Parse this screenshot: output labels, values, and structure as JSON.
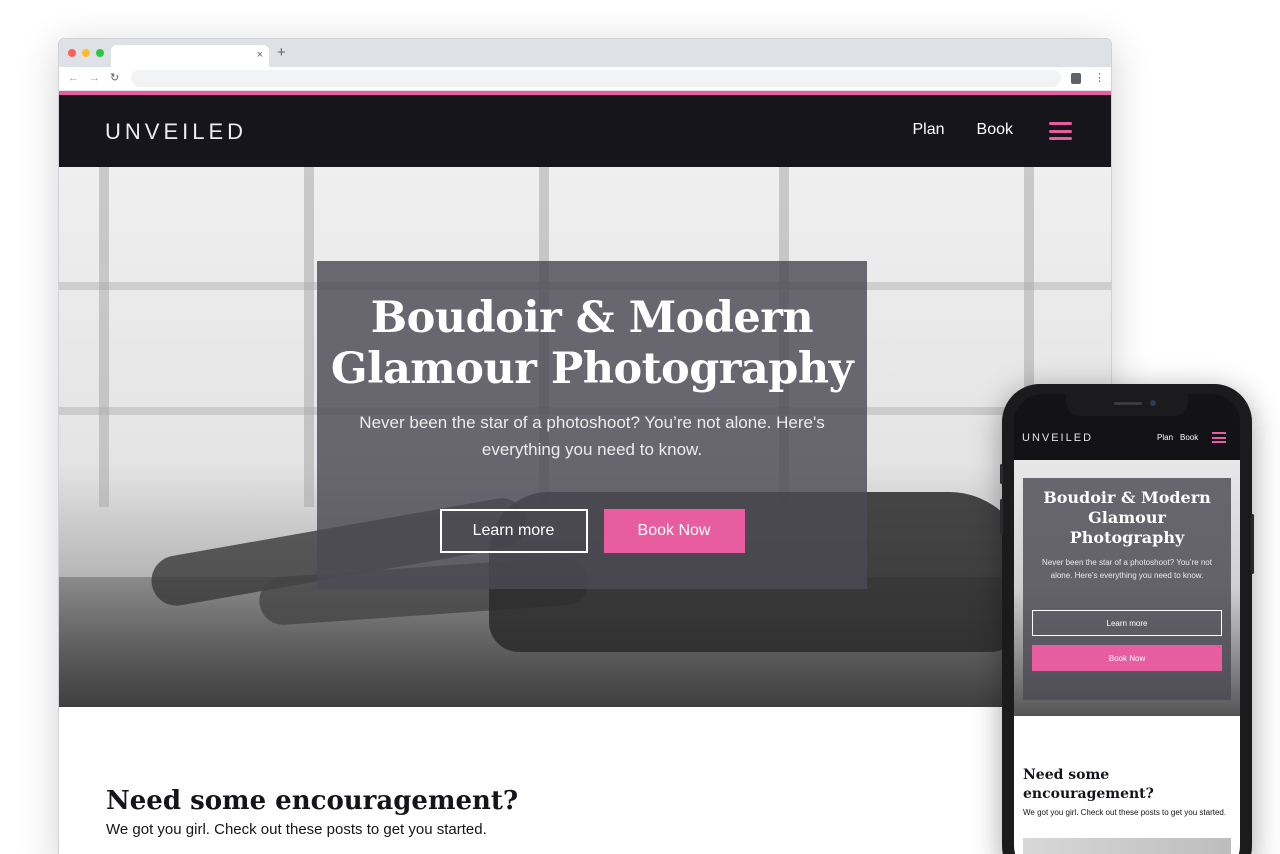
{
  "browser": {
    "tab_close_glyph": "×",
    "new_tab_glyph": "+",
    "back_glyph": "←",
    "forward_glyph": "→",
    "reload_glyph": "↻",
    "menu_glyph": "⋮"
  },
  "site": {
    "logo": "UNVEILED",
    "nav": [
      "Plan",
      "Book"
    ],
    "accent_color": "#e85ca0",
    "header_color": "#16151b"
  },
  "hero": {
    "title": "Boudoir & Modern Glamour Photography",
    "subtitle": "Never been the star of a photoshoot? You’re not alone. Here's everything you need to know.",
    "learn_more": "Learn more",
    "book_now": "Book Now"
  },
  "encouragement": {
    "heading": "Need some encouragement?",
    "text": "We got you girl. Check out these posts to get you started."
  }
}
